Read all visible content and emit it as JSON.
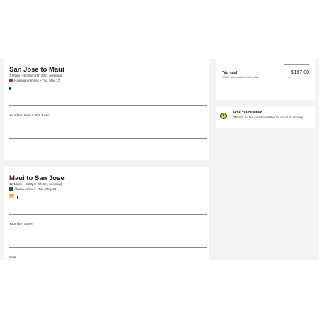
{
  "flights": [
    {
      "title": "San Jose to Maui",
      "time": "7:00am – 9:30am (5h 30m, nonstop)",
      "airline_line": "Hawaiian Airlines • Tue, May 17",
      "fare": "Your fare: Main Cabin Basic"
    },
    {
      "title": "Maui to San Jose",
      "time": "12:15pm – 8:20pm (5h 5m, nonstop)",
      "airline_line": "Alaska Airlines • Tue, May 24",
      "fare": "Your fare: Saver",
      "seat_label": "Seat"
    }
  ],
  "trip": {
    "label": "Trip total",
    "note": "Rates are quoted in US dollars",
    "price": "$197.00"
  },
  "cancellation": {
    "title": "Free cancellation",
    "text": "There's no fee to cancel within 24 hours of booking."
  },
  "colors": {
    "background": "#f5f3f1",
    "hawaiian_brand": "#b3125c",
    "alaska_brand": "#1e4f8f",
    "clock_yellow": "#f4d000"
  }
}
